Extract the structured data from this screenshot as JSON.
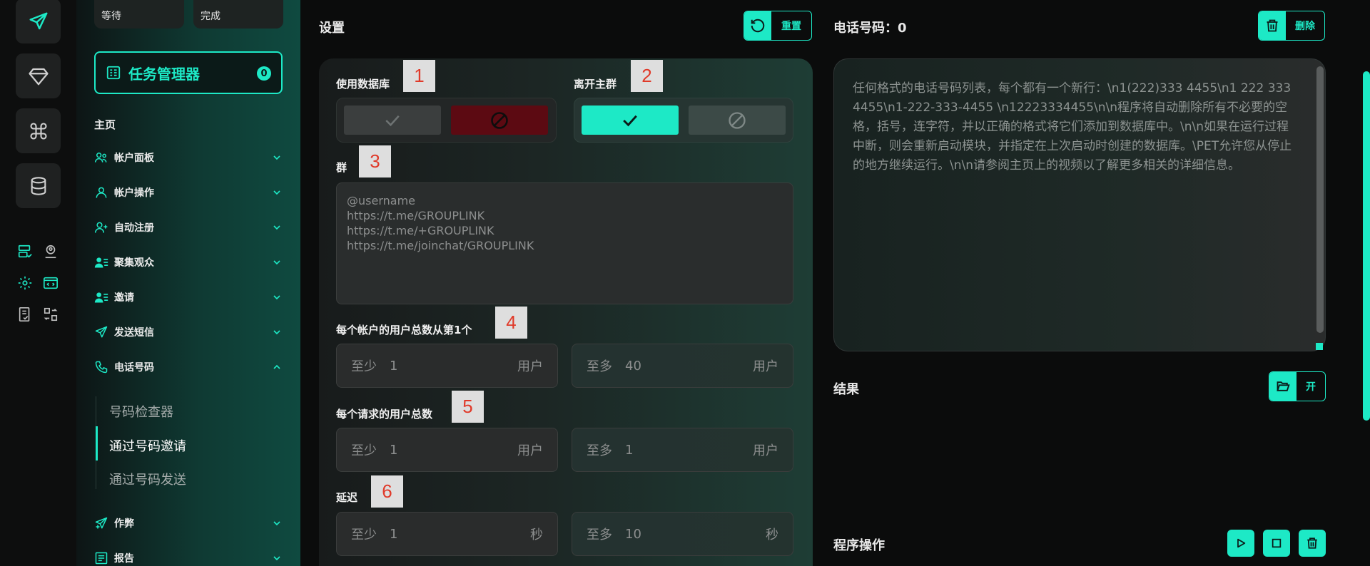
{
  "rail": {
    "icons": [
      "send-icon",
      "diamond-icon",
      "command-icon",
      "database-icon",
      "server-check-icon",
      "user-location-icon",
      "gear-icon",
      "code-window-icon",
      "checklist-icon",
      "swap-grid-icon"
    ]
  },
  "sidebar": {
    "stats": [
      {
        "label": "等待"
      },
      {
        "label": "完成"
      }
    ],
    "task_manager": {
      "label": "任务管理器",
      "count": "0"
    },
    "main_label": "主页",
    "items": [
      {
        "label": "帐户面板",
        "icon": "users-icon",
        "expanded": false
      },
      {
        "label": "帐户操作",
        "icon": "user-icon",
        "expanded": false
      },
      {
        "label": "自动注册",
        "icon": "user-plus-icon",
        "expanded": false
      },
      {
        "label": "聚集观众",
        "icon": "user-list-icon",
        "expanded": false
      },
      {
        "label": "邀请",
        "icon": "user-list-icon",
        "expanded": false
      },
      {
        "label": "发送短信",
        "icon": "send-icon",
        "expanded": false
      },
      {
        "label": "电话号码",
        "icon": "phone-icon",
        "expanded": true
      },
      {
        "label": "作弊",
        "icon": "send-plus-icon",
        "expanded": false
      },
      {
        "label": "报告",
        "icon": "report-icon",
        "expanded": false
      }
    ],
    "sub_items": [
      {
        "label": "号码检查器",
        "active": false
      },
      {
        "label": "通过号码邀请",
        "active": true
      },
      {
        "label": "通过号码发送",
        "active": false
      }
    ]
  },
  "settings": {
    "title": "设置",
    "reset_label": "重置",
    "use_db_label": "使用数据库",
    "leave_group_label": "离开主群",
    "group_label": "群",
    "group_placeholder": "@username\nhttps://t.me/GROUPLINK\nhttps://t.me/+GROUPLINK\nhttps://t.me/joinchat/GROUPLINK",
    "total_users_label": "每个帐户的用户总数从第1个",
    "per_request_label": "每个请求的用户总数",
    "delay_label": "延迟",
    "min_prefix": "至少",
    "max_prefix": "至多",
    "unit_users": "用户",
    "unit_seconds": "秒",
    "total_min": "1",
    "total_max": "40",
    "req_min": "1",
    "req_max": "1",
    "delay_min": "1",
    "delay_max": "10",
    "tags": [
      "1",
      "2",
      "3",
      "4",
      "5",
      "6"
    ]
  },
  "phones": {
    "title": "电话号码：0",
    "delete_label": "删除",
    "placeholder": "任何格式的电话号码列表，每个都有一个新行：\\n1(222)333 4455\\n1 222 333 4455\\n1-222-333-4455 \\n12223334455\\n\\n程序将自动删除所有不必要的空格，括号，连字符，并以正确的格式将它们添加到数据库中。\\n\\n如果在运行过程中断，则会重新启动模块，并指定在上次启动时创建的数据库。\\PET允许您从停止的地方继续运行。\\n\\n请参阅主页上的视频以了解更多相关的详细信息。",
    "results_label": "结果",
    "open_label": "开",
    "program_ops_label": "程序操作"
  },
  "colors": {
    "accent": "#1de9c6",
    "danger": "#5c0a12",
    "background": "#0b0c0c"
  }
}
